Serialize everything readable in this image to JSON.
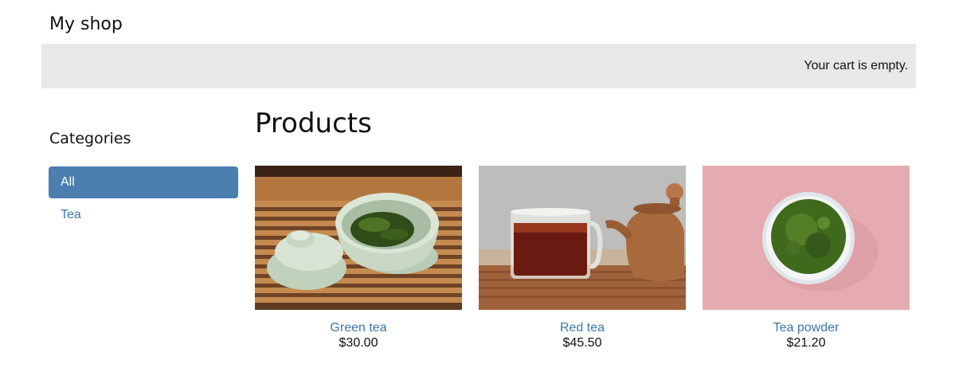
{
  "header": {
    "title": "My shop"
  },
  "cart": {
    "status": "Your cart is empty."
  },
  "sidebar": {
    "heading": "Categories",
    "items": [
      {
        "label": "All",
        "active": true
      },
      {
        "label": "Tea",
        "active": false
      }
    ]
  },
  "main": {
    "heading": "Products",
    "products": [
      {
        "name": "Green tea",
        "price": "$30.00",
        "image": "green-tea-photo"
      },
      {
        "name": "Red tea",
        "price": "$45.50",
        "image": "red-tea-photo"
      },
      {
        "name": "Tea powder",
        "price": "$21.20",
        "image": "tea-powder-photo"
      }
    ]
  },
  "colors": {
    "link": "#3a77a8",
    "active_category_bg": "#4a7fb0",
    "cart_bar_bg": "#e8e8e8"
  }
}
